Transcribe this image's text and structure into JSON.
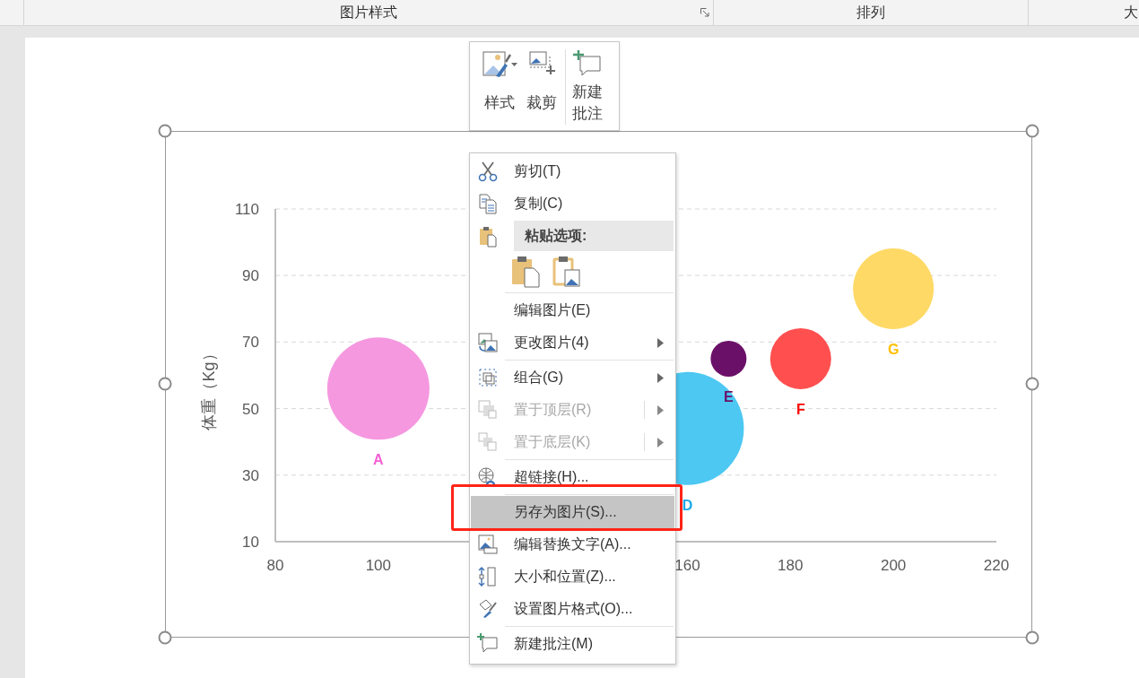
{
  "ribbon": {
    "groups": [
      {
        "label": "图片样式",
        "launcher": true
      },
      {
        "label": "排列"
      },
      {
        "label": "大"
      }
    ]
  },
  "mini_toolbar": {
    "buttons": [
      {
        "label": "样式",
        "dropdown": true
      },
      {
        "label": "裁剪",
        "dropdown": false
      },
      {
        "label": "新建批注",
        "dropdown": false
      }
    ]
  },
  "chart": {
    "chart_data": {
      "type": "scatter",
      "ylabel": "体重（Kg）",
      "xlim": [
        80,
        220
      ],
      "ylim": [
        10,
        110
      ],
      "grid": true,
      "xticks": [
        80,
        100,
        160,
        180,
        200,
        220
      ],
      "yticks": [
        10,
        30,
        50,
        70,
        90,
        110
      ],
      "series": [
        {
          "name": "A",
          "color": "#f598e0",
          "x": [
            100
          ],
          "values": [
            56
          ]
        },
        {
          "name": "D",
          "color": "#4cc8f2",
          "x": [
            160
          ],
          "values": [
            44
          ]
        },
        {
          "name": "E",
          "color": "#6b1068",
          "x": [
            168
          ],
          "values": [
            65
          ]
        },
        {
          "name": "F",
          "color": "#ff4f4f",
          "x": [
            182
          ],
          "values": [
            65
          ]
        },
        {
          "name": "G",
          "color": "#ffd966",
          "x": [
            200
          ],
          "values": [
            86
          ]
        }
      ]
    }
  },
  "context_menu": {
    "items": [
      {
        "kind": "item",
        "label": "剪切(T)",
        "submenu": false,
        "disabled": false,
        "highlighted": false
      },
      {
        "kind": "item",
        "label": "复制(C)",
        "submenu": false,
        "disabled": false,
        "highlighted": false
      },
      {
        "kind": "header",
        "label": "粘贴选项:"
      },
      {
        "kind": "paste"
      },
      {
        "kind": "separator"
      },
      {
        "kind": "item",
        "label": "编辑图片(E)",
        "submenu": false,
        "disabled": false,
        "highlighted": false
      },
      {
        "kind": "item",
        "label": "更改图片(4)",
        "submenu": true,
        "disabled": false,
        "highlighted": false
      },
      {
        "kind": "separator"
      },
      {
        "kind": "item",
        "label": "组合(G)",
        "submenu": true,
        "disabled": false,
        "highlighted": false
      },
      {
        "kind": "item",
        "label": "置于顶层(R)",
        "submenu": true,
        "disabled": true,
        "highlighted": false
      },
      {
        "kind": "item",
        "label": "置于底层(K)",
        "submenu": true,
        "disabled": true,
        "highlighted": false
      },
      {
        "kind": "separator"
      },
      {
        "kind": "item",
        "label": "超链接(H)...",
        "submenu": false,
        "disabled": false,
        "highlighted": false
      },
      {
        "kind": "separator"
      },
      {
        "kind": "item",
        "label": "另存为图片(S)...",
        "submenu": false,
        "disabled": false,
        "highlighted": true
      },
      {
        "kind": "item",
        "label": "编辑替换文字(A)...",
        "submenu": false,
        "disabled": false,
        "highlighted": false
      },
      {
        "kind": "item",
        "label": "大小和位置(Z)...",
        "submenu": false,
        "disabled": false,
        "highlighted": false
      },
      {
        "kind": "item",
        "label": "设置图片格式(O)...",
        "submenu": false,
        "disabled": false,
        "highlighted": false
      },
      {
        "kind": "separator"
      },
      {
        "kind": "item",
        "label": "新建批注(M)",
        "submenu": false,
        "disabled": false,
        "highlighted": false
      }
    ]
  }
}
